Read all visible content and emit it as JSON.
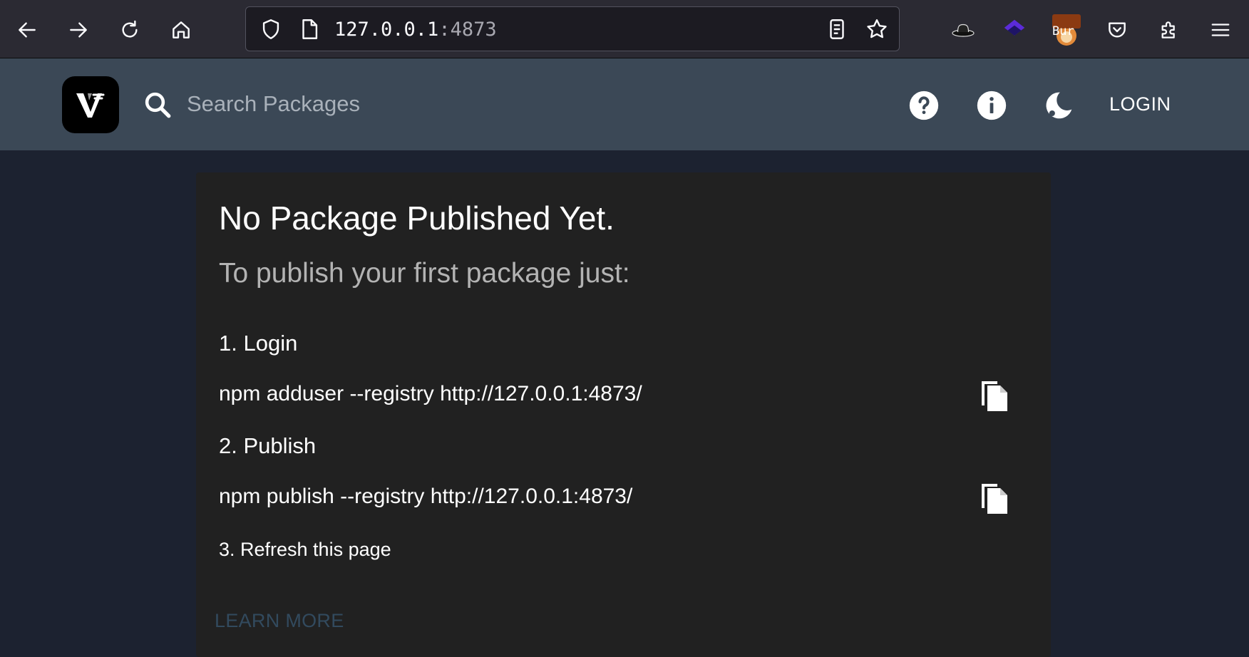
{
  "browser": {
    "url_host": "127.0.0.1",
    "url_port": ":4873",
    "extension_badge": "Bur"
  },
  "header": {
    "search_placeholder": "Search Packages",
    "login_label": "LOGIN",
    "icons": [
      "search-icon",
      "help-icon",
      "info-icon",
      "dark-mode-icon"
    ]
  },
  "main": {
    "title": "No Package Published Yet.",
    "subtitle": "To publish your first package just:",
    "step1": "1. Login",
    "cmd1": "npm adduser --registry http://127.0.0.1:4873/",
    "step2": "2. Publish",
    "cmd2": "npm publish --registry http://127.0.0.1:4873/",
    "step3": "3. Refresh this page",
    "learn_more": "LEARN MORE"
  },
  "colors": {
    "header_bg": "#3b4856",
    "page_bg": "#1c2230",
    "card_bg": "#212121",
    "browser_bg": "#2b2a33"
  }
}
